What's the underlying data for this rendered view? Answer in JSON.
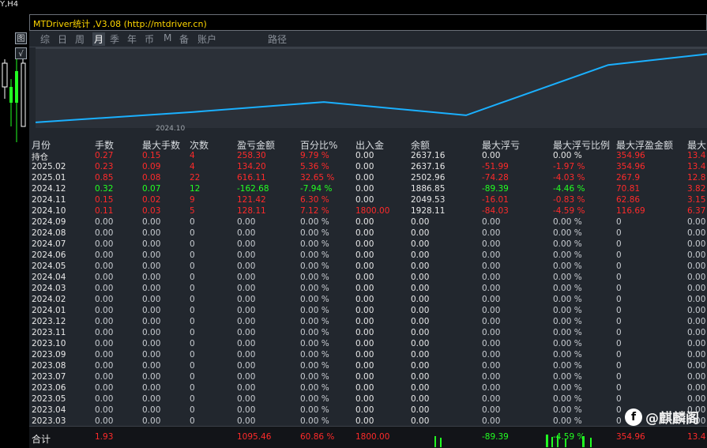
{
  "symbol": "Y,H4",
  "side_buttons": [
    "图",
    "√"
  ],
  "window": {
    "title": "MTDriver统计 ,V3.08 (http://mtdriver.cn)"
  },
  "tabs": [
    {
      "label": "综"
    },
    {
      "label": "日"
    },
    {
      "label": "周"
    },
    {
      "label": "月",
      "active": true
    },
    {
      "label": "季"
    },
    {
      "label": "年"
    },
    {
      "label": "币"
    },
    {
      "label": "M"
    },
    {
      "label": "备"
    },
    {
      "label": "账户"
    },
    {
      "label": "路径"
    }
  ],
  "chart": {
    "x_tick": "2024.10",
    "line_color": "#1ab0ff"
  },
  "chart_data": {
    "type": "line",
    "title": "",
    "xlabel": "",
    "ylabel": "",
    "x_ticks": [
      "2024.10"
    ],
    "series": [
      {
        "x": [
          "2024.10",
          "2024.11",
          "2024.12",
          "2025.01",
          "2025.02"
        ],
        "values": [
          1928.11,
          2049.53,
          1886.85,
          2502.96,
          2637.16
        ]
      }
    ]
  },
  "headers": [
    "月份",
    "手数",
    "最大手数",
    "次数",
    "盈亏金额",
    "百分比%",
    "出入金",
    "余额",
    "最大浮亏",
    "最大浮亏比例",
    "最大浮盈金额",
    "最大"
  ],
  "rows": [
    [
      "持仓",
      "0.27",
      "0.15",
      "4",
      "258.30",
      "9.79 %",
      "0.00",
      "2637.16",
      "0.00",
      "0.00 %",
      "354.96",
      "13.4"
    ],
    [
      "2025.02",
      "0.23",
      "0.09",
      "4",
      "134.20",
      "5.36 %",
      "0.00",
      "2637.16",
      "-51.99",
      "-1.97 %",
      "354.96",
      "13.4"
    ],
    [
      "2025.01",
      "0.85",
      "0.08",
      "22",
      "616.11",
      "32.65 %",
      "0.00",
      "2502.96",
      "-74.28",
      "-4.03 %",
      "267.9",
      "12.8"
    ],
    [
      "2024.12",
      "0.32",
      "0.07",
      "12",
      "-162.68",
      "-7.94 %",
      "0.00",
      "1886.85",
      "-89.39",
      "-4.46 %",
      "70.81",
      "3.82"
    ],
    [
      "2024.11",
      "0.15",
      "0.02",
      "9",
      "121.42",
      "6.30 %",
      "0.00",
      "2049.53",
      "-16.01",
      "-0.83 %",
      "62.86",
      "3.15"
    ],
    [
      "2024.10",
      "0.11",
      "0.03",
      "5",
      "128.11",
      "7.12 %",
      "1800.00",
      "1928.11",
      "-84.03",
      "-4.59 %",
      "116.69",
      "6.37"
    ],
    [
      "2024.09",
      "0.00",
      "0.00",
      "0",
      "0.00",
      "0.00 %",
      "0.00",
      "0.00",
      "0.00",
      "0.00 %",
      "0",
      "0.00"
    ],
    [
      "2024.08",
      "0.00",
      "0.00",
      "0",
      "0.00",
      "0.00 %",
      "0.00",
      "0.00",
      "0.00",
      "0.00 %",
      "0",
      "0.00"
    ],
    [
      "2024.07",
      "0.00",
      "0.00",
      "0",
      "0.00",
      "0.00 %",
      "0.00",
      "0.00",
      "0.00",
      "0.00 %",
      "0",
      "0.00"
    ],
    [
      "2024.06",
      "0.00",
      "0.00",
      "0",
      "0.00",
      "0.00 %",
      "0.00",
      "0.00",
      "0.00",
      "0.00 %",
      "0",
      "0.00"
    ],
    [
      "2024.05",
      "0.00",
      "0.00",
      "0",
      "0.00",
      "0.00 %",
      "0.00",
      "0.00",
      "0.00",
      "0.00 %",
      "0",
      "0.00"
    ],
    [
      "2024.04",
      "0.00",
      "0.00",
      "0",
      "0.00",
      "0.00 %",
      "0.00",
      "0.00",
      "0.00",
      "0.00 %",
      "0",
      "0.00"
    ],
    [
      "2024.03",
      "0.00",
      "0.00",
      "0",
      "0.00",
      "0.00 %",
      "0.00",
      "0.00",
      "0.00",
      "0.00 %",
      "0",
      "0.00"
    ],
    [
      "2024.02",
      "0.00",
      "0.00",
      "0",
      "0.00",
      "0.00 %",
      "0.00",
      "0.00",
      "0.00",
      "0.00 %",
      "0",
      "0.00"
    ],
    [
      "2024.01",
      "0.00",
      "0.00",
      "0",
      "0.00",
      "0.00 %",
      "0.00",
      "0.00",
      "0.00",
      "0.00 %",
      "0",
      "0.00"
    ],
    [
      "2023.12",
      "0.00",
      "0.00",
      "0",
      "0.00",
      "0.00 %",
      "0.00",
      "0.00",
      "0.00",
      "0.00 %",
      "0",
      "0.00"
    ],
    [
      "2023.11",
      "0.00",
      "0.00",
      "0",
      "0.00",
      "0.00 %",
      "0.00",
      "0.00",
      "0.00",
      "0.00 %",
      "0",
      "0.00"
    ],
    [
      "2023.10",
      "0.00",
      "0.00",
      "0",
      "0.00",
      "0.00 %",
      "0.00",
      "0.00",
      "0.00",
      "0.00 %",
      "0",
      "0.00"
    ],
    [
      "2023.09",
      "0.00",
      "0.00",
      "0",
      "0.00",
      "0.00 %",
      "0.00",
      "0.00",
      "0.00",
      "0.00 %",
      "0",
      "0.00"
    ],
    [
      "2023.08",
      "0.00",
      "0.00",
      "0",
      "0.00",
      "0.00 %",
      "0.00",
      "0.00",
      "0.00",
      "0.00 %",
      "0",
      "0.00"
    ],
    [
      "2023.07",
      "0.00",
      "0.00",
      "0",
      "0.00",
      "0.00 %",
      "0.00",
      "0.00",
      "0.00",
      "0.00 %",
      "0",
      "0.00"
    ],
    [
      "2023.06",
      "0.00",
      "0.00",
      "0",
      "0.00",
      "0.00 %",
      "0.00",
      "0.00",
      "0.00",
      "0.00 %",
      "0",
      "0.00"
    ],
    [
      "2023.05",
      "0.00",
      "0.00",
      "0",
      "0.00",
      "0.00 %",
      "0.00",
      "0.00",
      "0.00",
      "0.00 %",
      "0",
      "0.00"
    ],
    [
      "2023.04",
      "0.00",
      "0.00",
      "0",
      "0.00",
      "0.00 %",
      "0.00",
      "0.00",
      "0.00",
      "0.00 %",
      "0",
      "0.00"
    ],
    [
      "2023.03",
      "0.00",
      "0.00",
      "0",
      "0.00",
      "0.00 %",
      "0.00",
      "0.00",
      "0.00",
      "0.00 %",
      "0",
      "0.00"
    ]
  ],
  "row_colors": [
    "red",
    "red",
    "red",
    "green",
    "red",
    "red",
    "gray",
    "gray",
    "gray",
    "gray",
    "gray",
    "gray",
    "gray",
    "gray",
    "gray",
    "gray",
    "gray",
    "gray",
    "gray",
    "gray",
    "gray",
    "gray",
    "gray",
    "gray",
    "gray"
  ],
  "footer": [
    "合计",
    "1.93",
    "",
    "",
    "1095.46",
    "60.86 %",
    "1800.00",
    "",
    "-89.39",
    "-4.59 %",
    "354.96",
    "13.4"
  ],
  "footer_colors": [
    "white",
    "red",
    "red",
    "red",
    "red",
    "red",
    "red",
    "gray",
    "green",
    "green",
    "red",
    "red"
  ],
  "watermark": {
    "text": "@麒麟阁",
    "logo": "f-logo-icon"
  },
  "colors": {
    "red": "#ff2a2a",
    "green": "#22ff22",
    "title": "#ffd700",
    "line": "#1ab0ff"
  }
}
